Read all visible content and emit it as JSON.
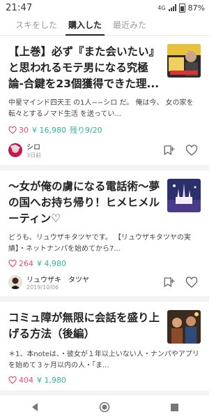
{
  "status_bar": {
    "time": "21:47",
    "network": "4G",
    "battery": "87%"
  },
  "tabs": [
    {
      "label": "スキをした"
    },
    {
      "label": "購入した"
    },
    {
      "label": "最近みた"
    }
  ],
  "articles": [
    {
      "title": "【上巻】必ず『また会いたい』と思われるモテ男になる究極論-合鍵を23個獲得できた理...",
      "excerpt": "中星マインド四天王 の1人−−シロ だ。 俺は今、 女の家を転々とするノマド生活 を送ってい...",
      "likes": "30",
      "price": "¥ 16,980",
      "remaining": "残り9/20",
      "author": "シロ",
      "date": "3日前"
    },
    {
      "title": "〜女が俺の虜になる電話術〜夢の国へお持ち帰り！ヒメヒメルーティン♡",
      "excerpt": "どうも、リュウザキタツヤです。 【リュウザキタツヤの実績】・ネットナンパを始めてから7...",
      "likes": "264",
      "price": "¥ 4,980",
      "author": "リュウザキ　タツヤ",
      "date": "2019/10/06"
    },
    {
      "title": "コミュ障が無限に会話を盛り上げる方法（後編）",
      "excerpt": "＊1、本noteは、・彼女が１年以上いない人・ナンパやアプリを始めて３ヶ月以内の人・「ま...",
      "likes": "404",
      "price": "¥ 1,980"
    }
  ],
  "icons": {
    "heart": "heart-icon",
    "bookmark": "bookmark-add-icon",
    "back": "back-icon",
    "home": "home-icon",
    "recents": "recents-icon"
  },
  "colors": {
    "like": "#e8506e",
    "price": "#2cb696",
    "text": "#222222"
  }
}
